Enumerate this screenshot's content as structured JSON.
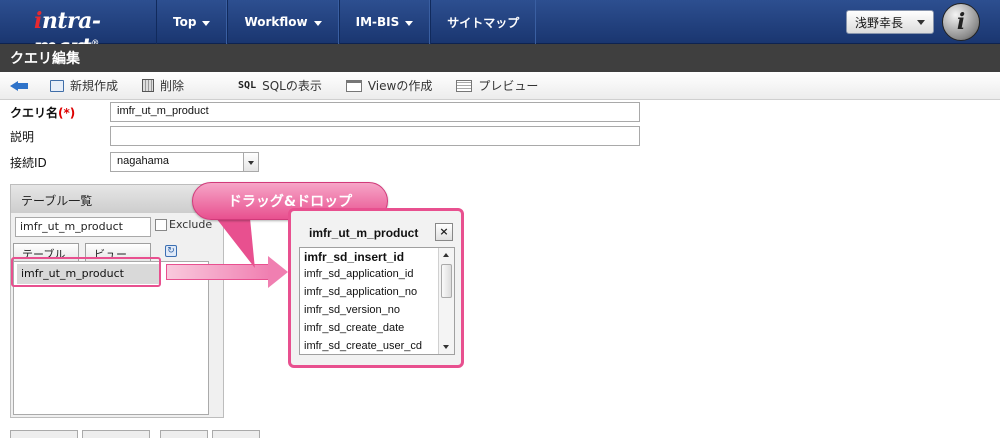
{
  "app": {
    "logo_main": "ntra-mart",
    "logo_i": "i",
    "logo_reg": "®",
    "user_name": "浅野幸長",
    "brand_letter": "i"
  },
  "nav": {
    "items": [
      {
        "label": "Top",
        "has_menu": true
      },
      {
        "label": "Workflow",
        "has_menu": true
      },
      {
        "label": "IM-BIS",
        "has_menu": true
      },
      {
        "label": "サイトマップ",
        "has_menu": false
      }
    ]
  },
  "page": {
    "title": "クエリ編集"
  },
  "toolbar": {
    "new_label": "新規作成",
    "delete_label": "削除",
    "sql_icon_text": "SQL",
    "sql_label": "SQLの表示",
    "view_label": "Viewの作成",
    "preview_label": "プレビュー"
  },
  "form": {
    "query_name_label": "クエリ名",
    "required_mark": "(*)",
    "query_name_value": "imfr_ut_m_product",
    "description_label": "説明",
    "description_value": "",
    "connection_label": "接続ID",
    "connection_value": "nagahama"
  },
  "table_panel": {
    "title": "テーブル一覧",
    "filter_value": "imfr_ut_m_product",
    "exclude_label": "Exclude",
    "tab_table": "テーブル",
    "tab_view": "ビュー",
    "refresh_icon": "↻",
    "items": [
      "imfr_ut_m_product"
    ]
  },
  "callout": {
    "text": "ドラッグ&ドロップ"
  },
  "dropped_table": {
    "title": "imfr_ut_m_product",
    "close_label": "×",
    "columns": [
      "imfr_sd_insert_id",
      "imfr_sd_application_id",
      "imfr_sd_application_no",
      "imfr_sd_version_no",
      "imfr_sd_create_date",
      "imfr_sd_create_user_cd"
    ]
  },
  "colors": {
    "nav_bg": "#1f3c78",
    "title_bar_bg": "#3f3f3f",
    "highlight_pink": "#e8508f",
    "required_red": "#dd0000"
  }
}
